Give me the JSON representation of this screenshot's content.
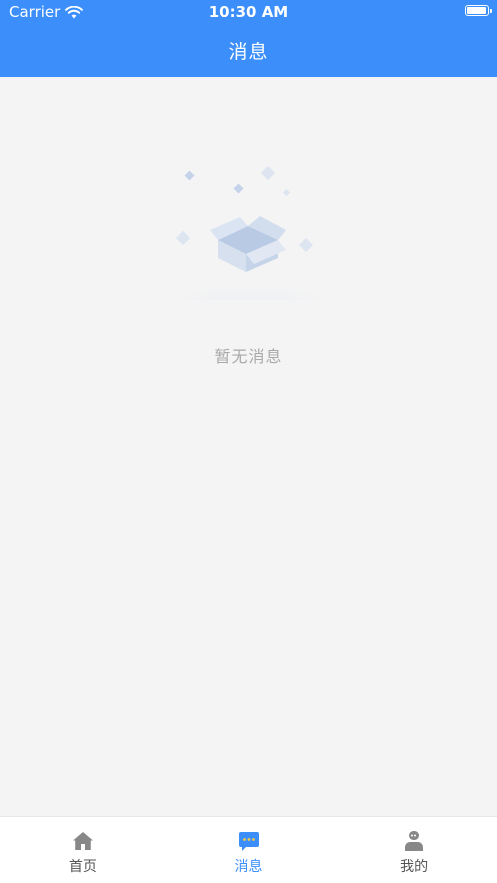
{
  "status_bar": {
    "carrier": "Carrier",
    "time": "10:30 AM"
  },
  "header": {
    "title": "消息"
  },
  "empty_state": {
    "message": "暂无消息"
  },
  "tab_bar": {
    "items": [
      {
        "label": "首页",
        "icon": "home-icon",
        "active": false
      },
      {
        "label": "消息",
        "icon": "message-icon",
        "active": true
      },
      {
        "label": "我的",
        "icon": "profile-icon",
        "active": false
      }
    ]
  },
  "colors": {
    "accent": "#3c8ffb",
    "background": "#f4f4f4",
    "inactive_tab": "#555555",
    "empty_text": "#a9a9a9"
  }
}
